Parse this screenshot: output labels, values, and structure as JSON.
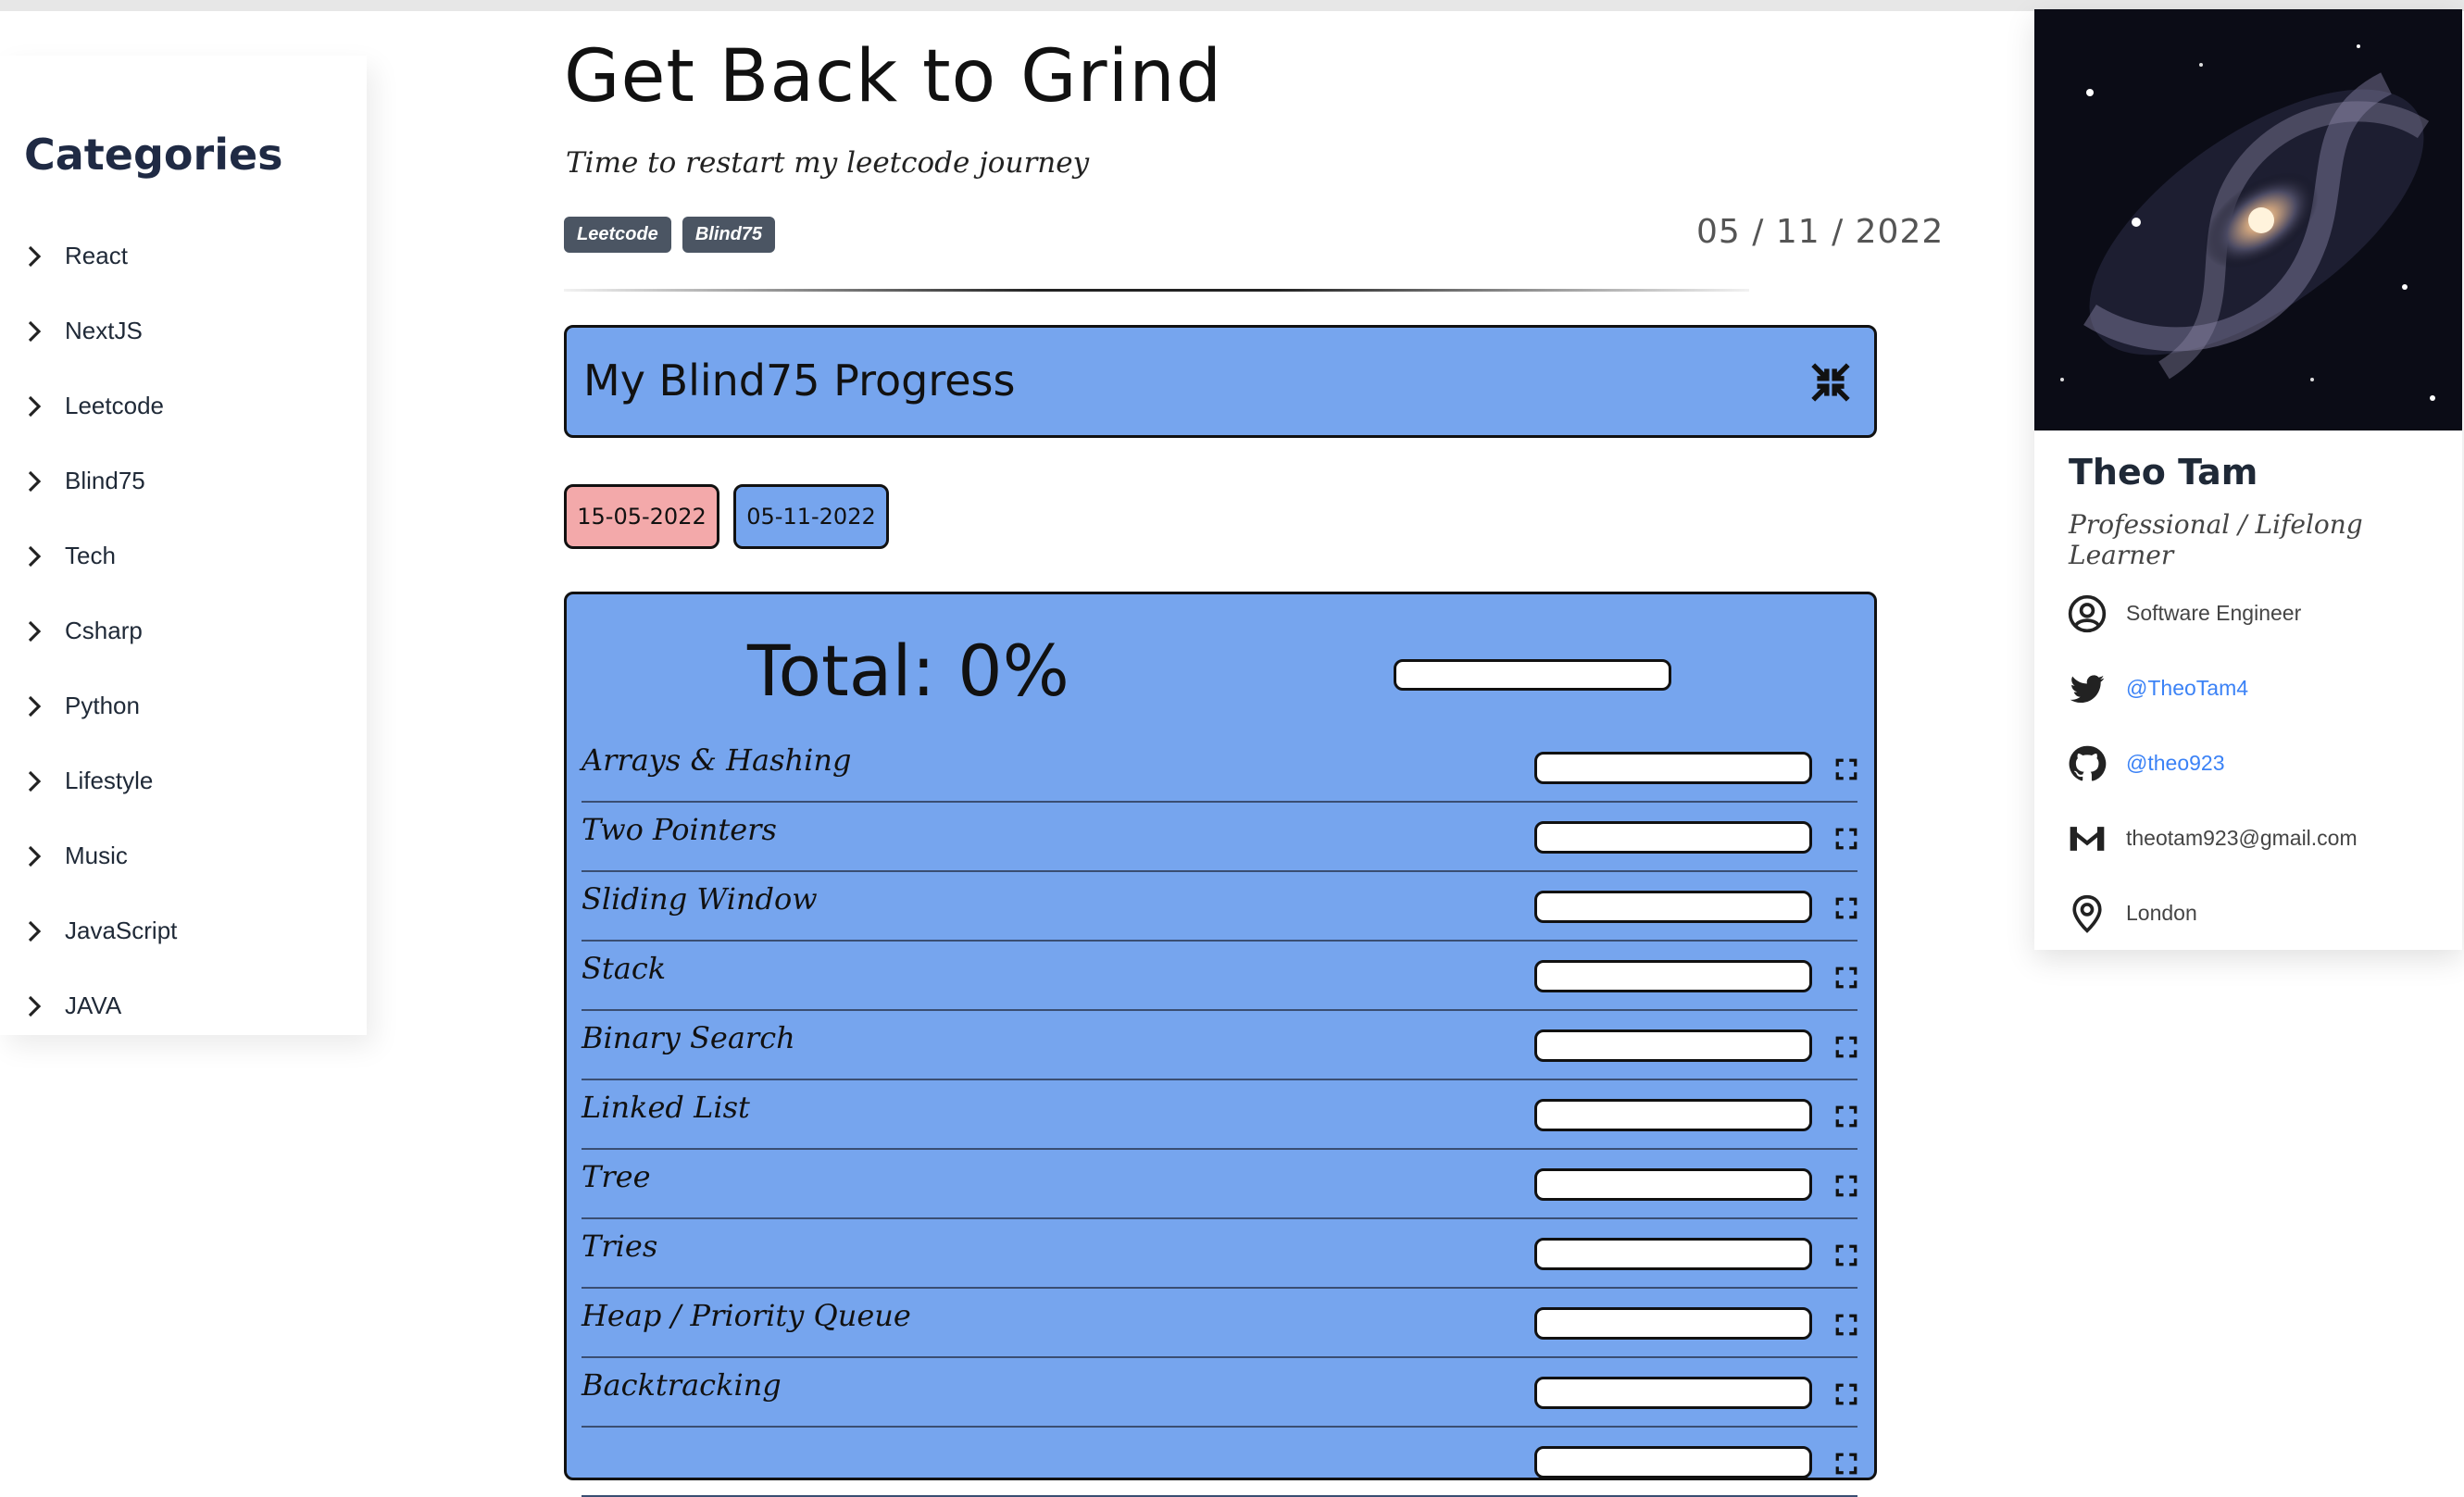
{
  "sidebar": {
    "heading": "Categories",
    "items": [
      "React",
      "NextJS",
      "Leetcode",
      "Blind75",
      "Tech",
      "Csharp",
      "Python",
      "Lifestyle",
      "Music",
      "JavaScript",
      "JAVA"
    ]
  },
  "post": {
    "title": "Get Back to Grind",
    "subtitle": "Time to restart my leetcode journey",
    "tags": [
      "Leetcode",
      "Blind75"
    ],
    "date": "05 / 11 / 2022"
  },
  "progress": {
    "heading": "My Blind75 Progress",
    "start_date": "15-05-2022",
    "end_date": "05-11-2022",
    "total_label": "Total: 0%",
    "total_percent": 0,
    "topics": [
      {
        "name": "Arrays & Hashing",
        "percent": 0
      },
      {
        "name": "Two Pointers",
        "percent": 0
      },
      {
        "name": "Sliding Window",
        "percent": 0
      },
      {
        "name": "Stack",
        "percent": 0
      },
      {
        "name": "Binary Search",
        "percent": 0
      },
      {
        "name": "Linked List",
        "percent": 0
      },
      {
        "name": "Tree",
        "percent": 0
      },
      {
        "name": "Tries",
        "percent": 0
      },
      {
        "name": "Heap / Priority Queue",
        "percent": 0
      },
      {
        "name": "Backtracking",
        "percent": 0
      },
      {
        "name": "",
        "percent": 0
      }
    ]
  },
  "profile": {
    "name": "Theo Tam",
    "role": "Professional / Lifelong Learner",
    "job": "Software Engineer",
    "twitter": "@TheoTam4",
    "github": "@theo923",
    "email": "theotam923@gmail.com",
    "location": "London"
  },
  "colors": {
    "panel_blue": "#76a5ee",
    "start_pink": "#f3a9aa",
    "tag_gray": "#4b5563",
    "link_blue": "#3b82f6"
  }
}
